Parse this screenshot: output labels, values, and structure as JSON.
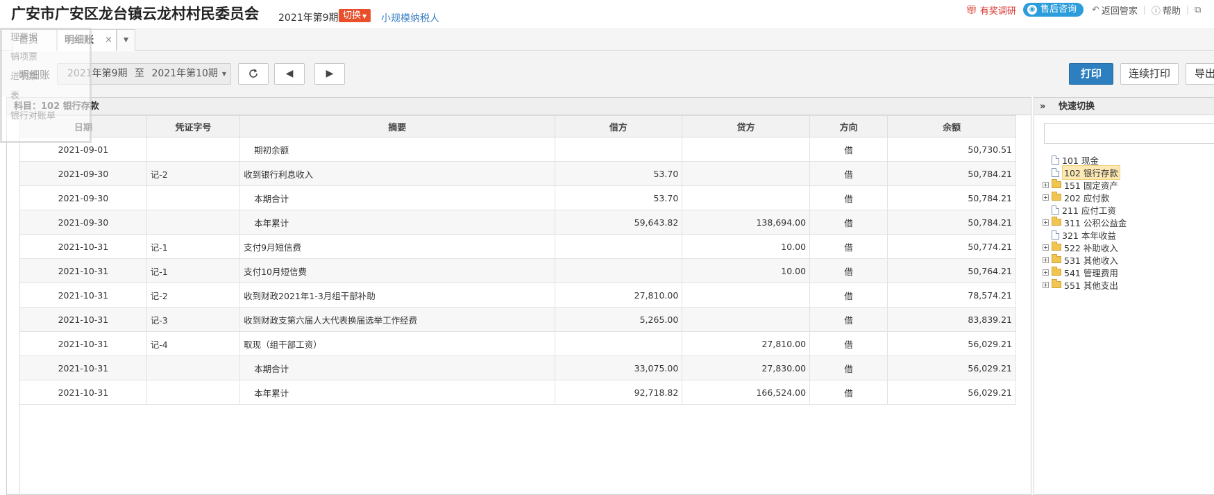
{
  "header": {
    "org_title": "广安市广安区龙台镇云龙村村民委员会",
    "period": "2021年第9期",
    "switch_label": "切换",
    "taxpayer_type": "小规模纳税人",
    "links": {
      "survey": "有奖调研",
      "consult": "售后咨询",
      "back": "返回管家",
      "help": "帮助"
    }
  },
  "tabs": {
    "home": "首页",
    "ledger": "明细账",
    "close": "×"
  },
  "ghost_menu": [
    "理票据",
    "销项票",
    "进项票",
    "表",
    "银行对账单"
  ],
  "toolbar": {
    "label": "明细账",
    "range_from": "2021年第9期",
    "range_to_word": "至",
    "range_to": "2021年第10期",
    "print": "打印",
    "continuous_print": "连续打印",
    "export": "导出"
  },
  "subject": "科目：102  银行存款",
  "table": {
    "columns": [
      "日期",
      "凭证字号",
      "摘要",
      "借方",
      "贷方",
      "方向",
      "余额"
    ],
    "rows": [
      {
        "date": "2021-09-01",
        "voucher": "",
        "summary": "期初余额",
        "debit": "",
        "credit": "",
        "dir": "借",
        "balance": "50,730.51",
        "sub": true
      },
      {
        "date": "2021-09-30",
        "voucher": "记-2",
        "summary": "收到银行利息收入",
        "debit": "53.70",
        "credit": "",
        "dir": "借",
        "balance": "50,784.21",
        "sub": false
      },
      {
        "date": "2021-09-30",
        "voucher": "",
        "summary": "本期合计",
        "debit": "53.70",
        "credit": "",
        "dir": "借",
        "balance": "50,784.21",
        "sub": true
      },
      {
        "date": "2021-09-30",
        "voucher": "",
        "summary": "本年累计",
        "debit": "59,643.82",
        "credit": "138,694.00",
        "dir": "借",
        "balance": "50,784.21",
        "sub": true
      },
      {
        "date": "2021-10-31",
        "voucher": "记-1",
        "summary": "支付9月短信费",
        "debit": "",
        "credit": "10.00",
        "dir": "借",
        "balance": "50,774.21",
        "sub": false
      },
      {
        "date": "2021-10-31",
        "voucher": "记-1",
        "summary": "支付10月短信费",
        "debit": "",
        "credit": "10.00",
        "dir": "借",
        "balance": "50,764.21",
        "sub": false
      },
      {
        "date": "2021-10-31",
        "voucher": "记-2",
        "summary": "收到财政2021年1-3月组干部补助",
        "debit": "27,810.00",
        "credit": "",
        "dir": "借",
        "balance": "78,574.21",
        "sub": false
      },
      {
        "date": "2021-10-31",
        "voucher": "记-3",
        "summary": "收到财政支第六届人大代表换届选举工作经费",
        "debit": "5,265.00",
        "credit": "",
        "dir": "借",
        "balance": "83,839.21",
        "sub": false
      },
      {
        "date": "2021-10-31",
        "voucher": "记-4",
        "summary": "取现（组干部工资）",
        "debit": "",
        "credit": "27,810.00",
        "dir": "借",
        "balance": "56,029.21",
        "sub": false
      },
      {
        "date": "2021-10-31",
        "voucher": "",
        "summary": "本期合计",
        "debit": "33,075.00",
        "credit": "27,830.00",
        "dir": "借",
        "balance": "56,029.21",
        "sub": true
      },
      {
        "date": "2021-10-31",
        "voucher": "",
        "summary": "本年累计",
        "debit": "92,718.82",
        "credit": "166,524.00",
        "dir": "借",
        "balance": "56,029.21",
        "sub": true
      }
    ]
  },
  "quick_switch": {
    "title": "快速切换",
    "chevron": "»",
    "search_value": "",
    "items": [
      {
        "label": "101 现金",
        "kind": "file",
        "expandable": false,
        "selected": false
      },
      {
        "label": "102 银行存款",
        "kind": "file",
        "expandable": false,
        "selected": true
      },
      {
        "label": "151 固定资产",
        "kind": "folder",
        "expandable": true,
        "selected": false
      },
      {
        "label": "202 应付款",
        "kind": "folder",
        "expandable": true,
        "selected": false
      },
      {
        "label": "211 应付工资",
        "kind": "file",
        "expandable": false,
        "selected": false
      },
      {
        "label": "311 公积公益金",
        "kind": "folder",
        "expandable": true,
        "selected": false
      },
      {
        "label": "321 本年收益",
        "kind": "file",
        "expandable": false,
        "selected": false
      },
      {
        "label": "522 补助收入",
        "kind": "folder",
        "expandable": true,
        "selected": false
      },
      {
        "label": "531 其他收入",
        "kind": "folder",
        "expandable": true,
        "selected": false
      },
      {
        "label": "541 管理费用",
        "kind": "folder",
        "expandable": true,
        "selected": false
      },
      {
        "label": "551 其他支出",
        "kind": "folder",
        "expandable": true,
        "selected": false
      }
    ]
  },
  "icons": {
    "gift": "gift-icon",
    "eye": "eye-icon",
    "back": "back-arrow-icon",
    "help": "help-icon",
    "refresh": "refresh-icon",
    "prev": "triangle-left-icon",
    "next": "triangle-right-icon"
  },
  "colors": {
    "switch_bg": "#e94f2b",
    "link": "#3a7fc2",
    "print_bg": "#2d7fc0",
    "consult_bg": "#2b9cdc",
    "survey": "#d9322a"
  }
}
